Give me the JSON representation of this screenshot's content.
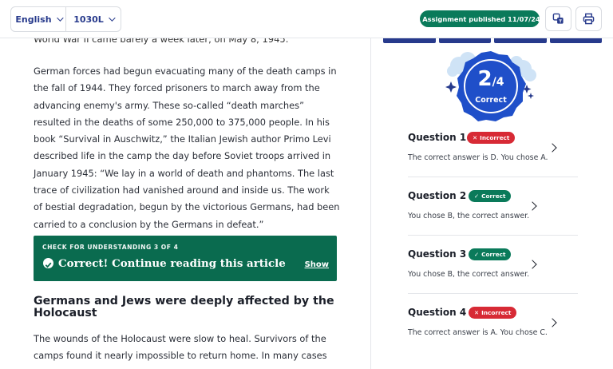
{
  "toolbar": {
    "language": "English",
    "reading_level": "1030L",
    "published_badge": "Assignment published 11/07/24",
    "translate_icon": "translate-icon",
    "print_icon": "print-icon",
    "accent": "#273a8c",
    "success": "#0a7a5a"
  },
  "article": {
    "cut_line": "World War II came barely a week later, on May 8, 1945.",
    "paragraphs": [
      "German forces had begun evacuating many of the death camps in the fall of 1944. They forced prisoners to march away from the advancing enemy's army. These so-called “death marches” resulted in the deaths of some 250,000 to 375,000 people. In his book “Survival in Auschwitz,” the Italian Jewish author Primo Levi described life in the camp the day before Soviet troops arrived in January 1945: “We lay in a world of death and phantoms. The last trace of civilization had vanished around and inside us. The work of bestial degradation, begun by the victorious Germans, had been carried to a conclusion by the Germans in defeat.”",
      "The wounds of the Holocaust were slow to heal. Survivors of the camps found it nearly impossible to return home. In many cases they had lost"
    ],
    "check": {
      "kicker": "CHECK FOR UNDERSTANDING 3 OF 4",
      "title": "Correct! Continue reading this article",
      "show": "Show"
    },
    "section_heading": "Germans and Jews were deeply affected by the Holocaust"
  },
  "results": {
    "score": "2",
    "total": "/4",
    "score_label": "Correct",
    "questions": [
      {
        "title": "Question 1",
        "status": "Incorrect",
        "correct": false,
        "text": "The correct answer is D. You chose A."
      },
      {
        "title": "Question 2",
        "status": "Correct",
        "correct": true,
        "text": "You chose B, the correct answer."
      },
      {
        "title": "Question 3",
        "status": "Correct",
        "correct": true,
        "text": "You chose B, the correct answer."
      },
      {
        "title": "Question 4",
        "status": "Incorrect",
        "correct": false,
        "text": "The correct answer is A. You chose C."
      }
    ]
  }
}
